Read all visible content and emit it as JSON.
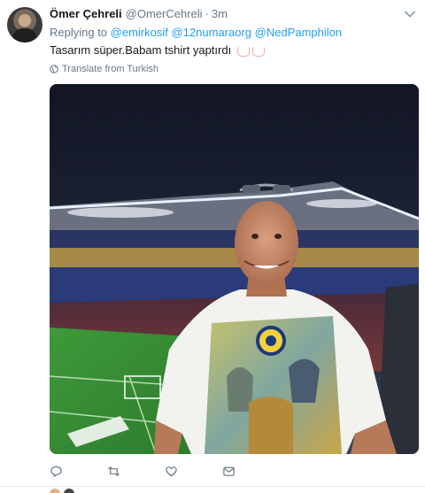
{
  "tweet": {
    "author_name": "Ömer Çehreli",
    "author_handle": "@OmerCehreli",
    "separator": "·",
    "timestamp": "3m",
    "reply": {
      "prefix": "Replying to",
      "mentions": [
        "@emirkosif",
        "@12numaraorg",
        "@NedPamphilon"
      ]
    },
    "text": "Tasarım süper.Babam tshirt yaptırdı",
    "emoji_count": 2,
    "translate_label": "Translate from Turkish"
  },
  "icons": {
    "caret": "chevron-down-icon",
    "translate": "globe-icon",
    "actions": [
      "reply-icon",
      "retweet-icon",
      "like-icon",
      "message-icon"
    ]
  },
  "colors": {
    "text": "#14171a",
    "secondary": "#657786",
    "link": "#1da1f2",
    "divider": "#e6ecf0"
  }
}
